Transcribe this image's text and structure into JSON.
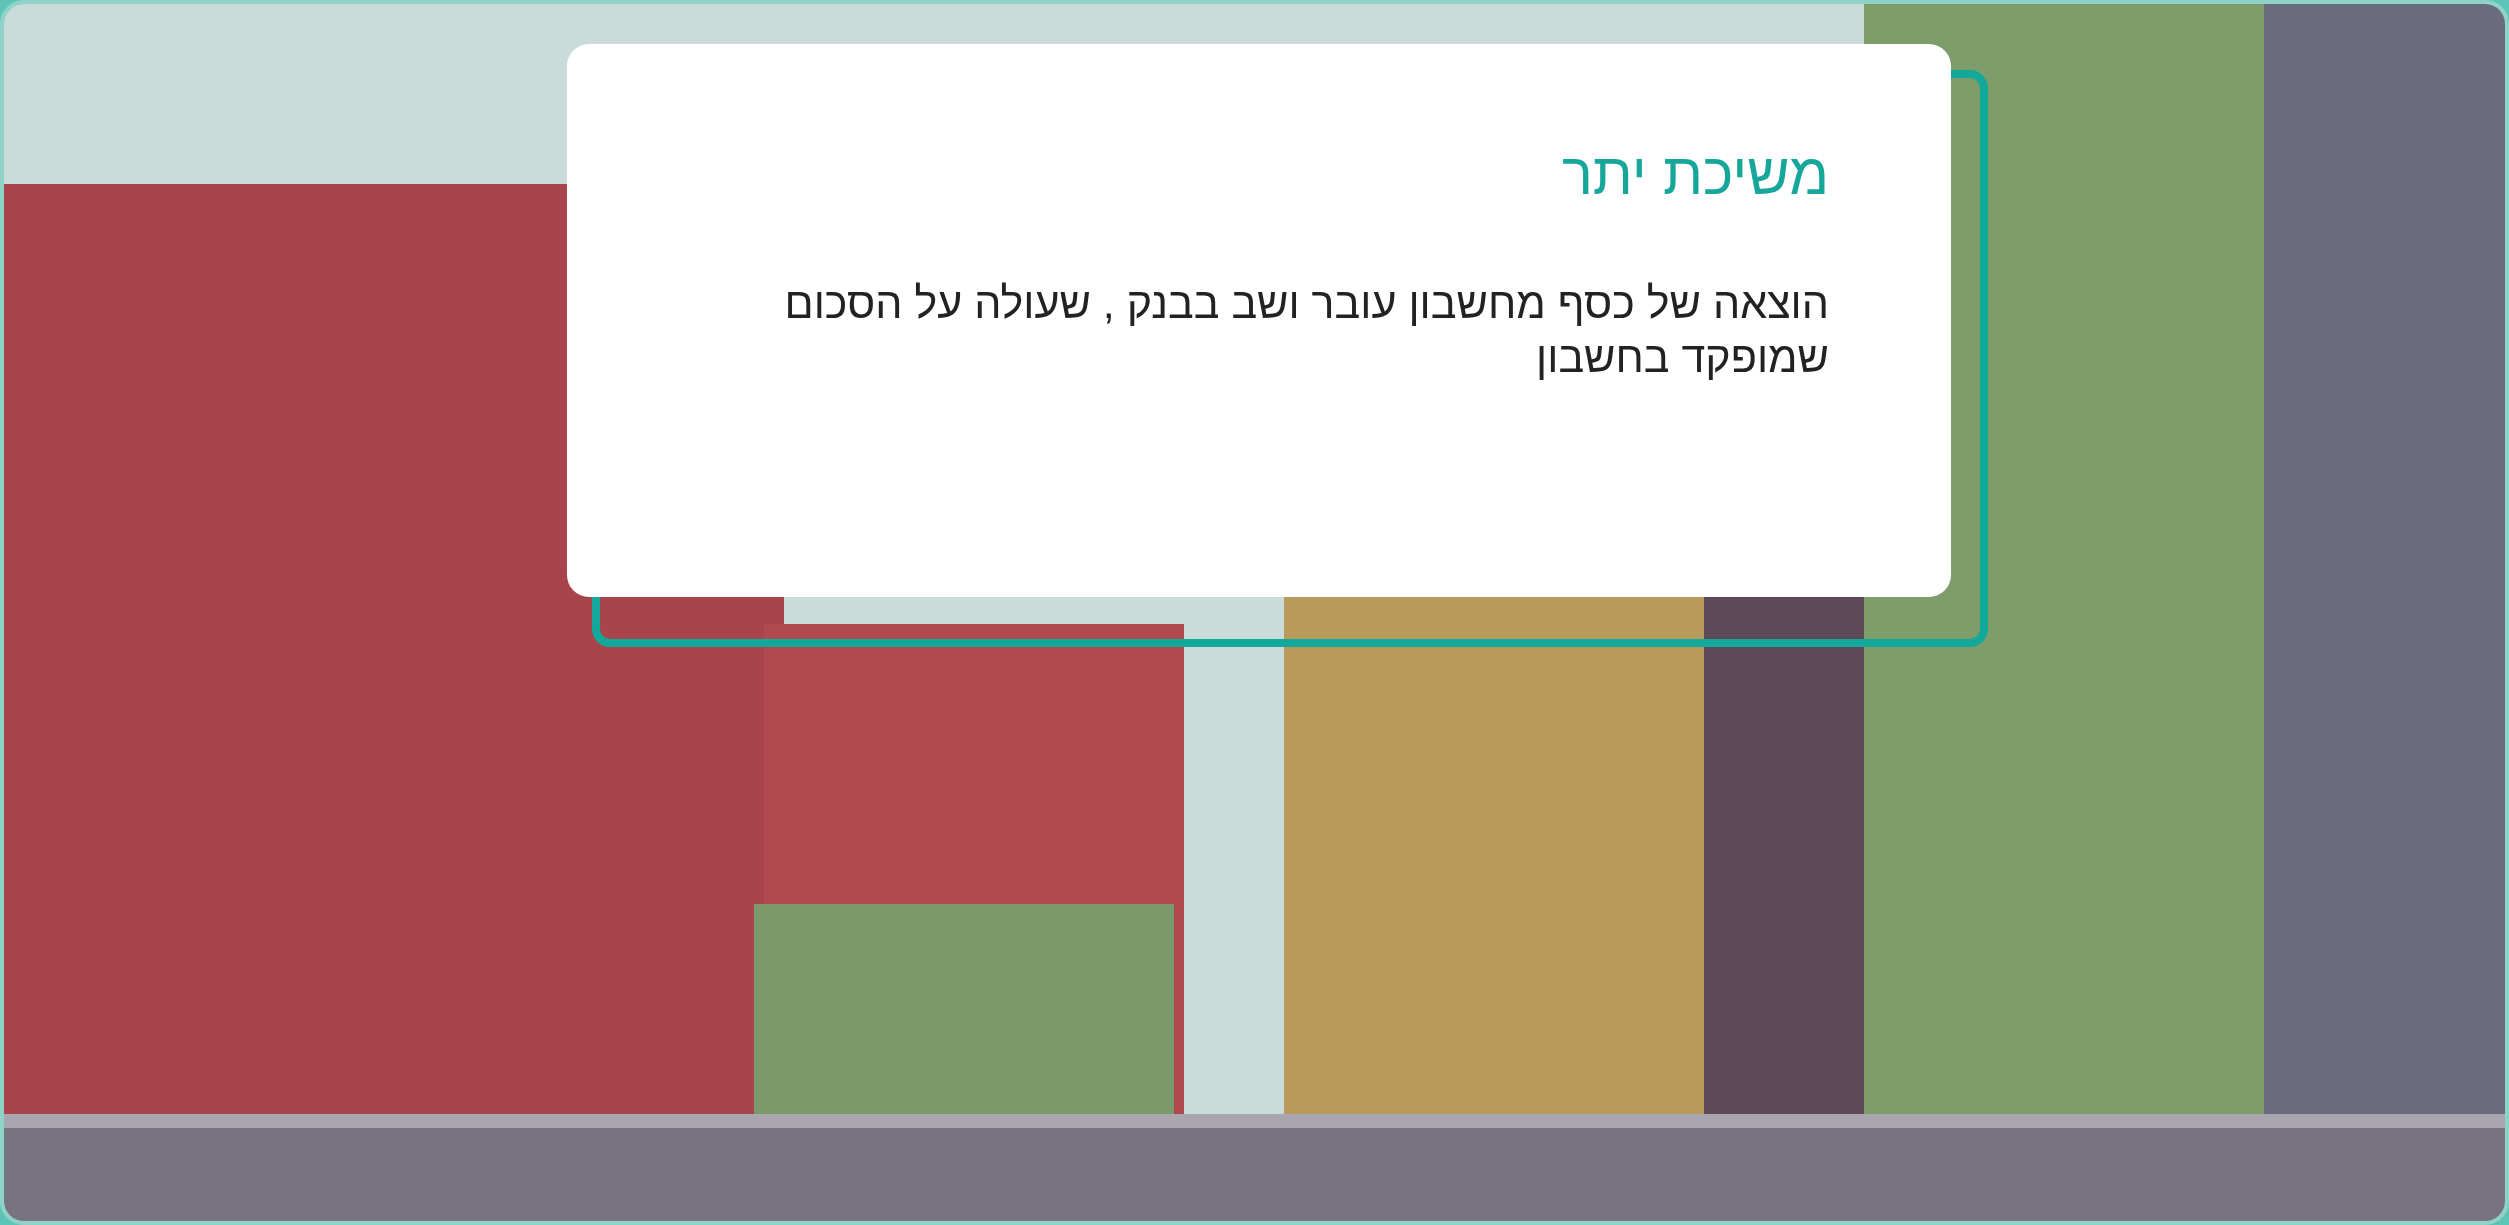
{
  "card": {
    "title": "משיכת יתר",
    "body": "הוצאה של כסף מחשבון עובר ושב בבנק , שעולה על הסכום שמופקד בחשבון"
  }
}
